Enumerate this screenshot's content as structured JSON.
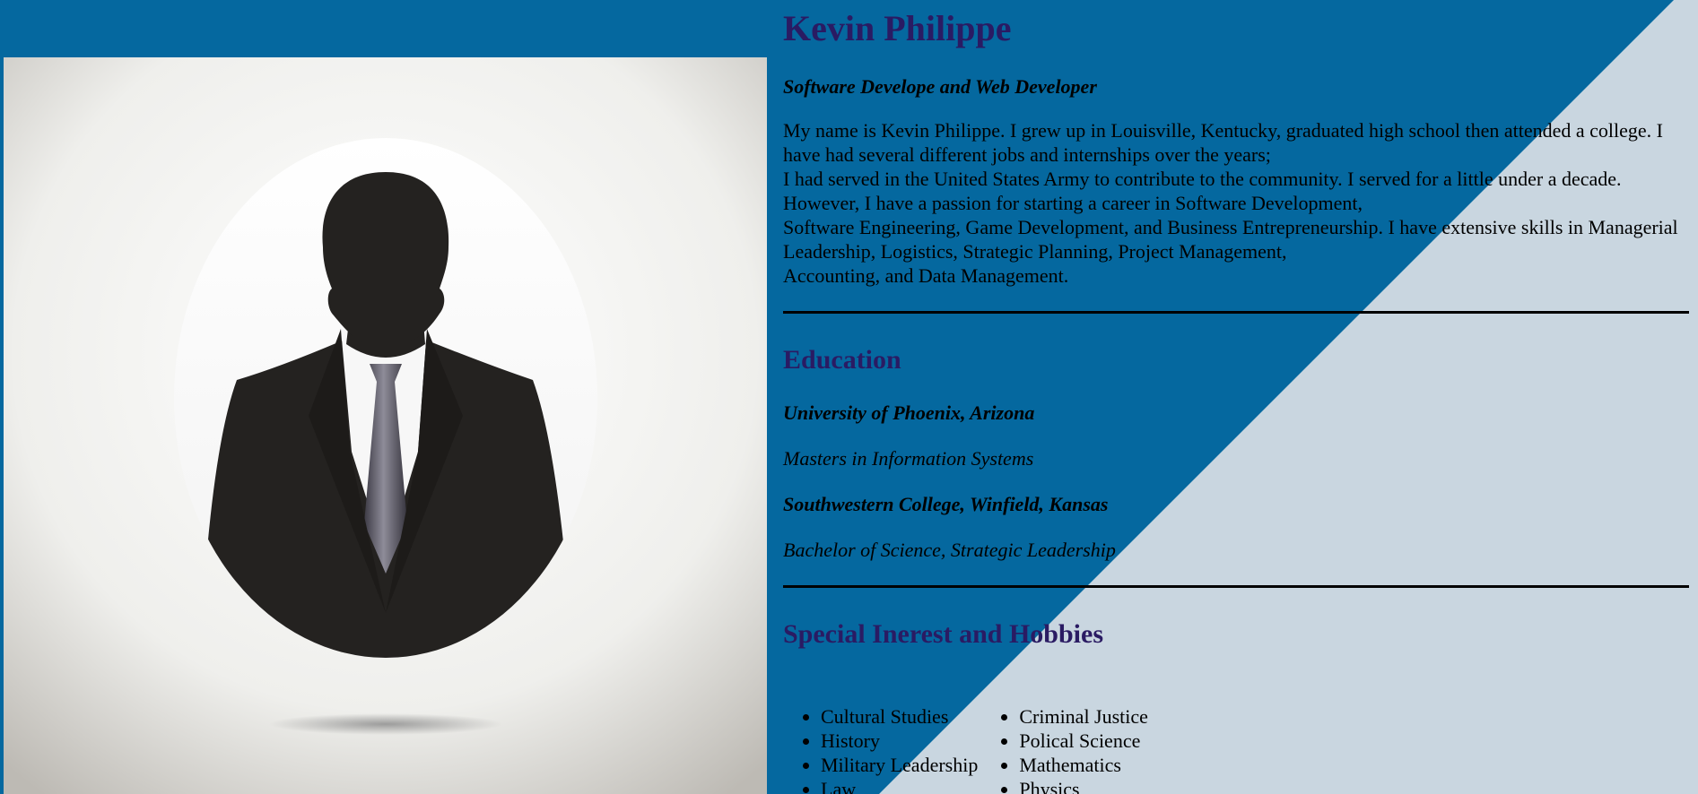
{
  "profile": {
    "name": "Kevin Philippe",
    "title": "Software Develope and Web Developer",
    "bio": [
      "My name is Kevin Philippe. I grew up in Louisville, Kentucky, graduated high school then attended a college. I have had several different jobs and internships over the years;",
      "I had served in the United States Army to contribute to the community. I served for a little under a decade. However, I have a passion for starting a career in Software Development,",
      "Software Engineering, Game Development, and Business Entrepreneurship. I have extensive skills in Managerial Leadership, Logistics, Strategic Planning, Project Management,",
      "Accounting, and Data Management."
    ]
  },
  "education": {
    "heading": "Education",
    "entries": [
      {
        "school": "University of Phoenix, Arizona",
        "degree": "Masters in Information Systems"
      },
      {
        "school": "Southwestern College, Winfield, Kansas",
        "degree": "Bachelor of Science, Strategic Leadership"
      }
    ]
  },
  "hobbies": {
    "heading": "Special Inerest and Hobbies",
    "column1": [
      "Cultural Studies",
      "History",
      "Military Leadership",
      "Law"
    ],
    "column2": [
      "Criminal Justice",
      "Polical Science",
      "Mathematics",
      "Physics"
    ]
  },
  "colors": {
    "blue": "#05689f",
    "light": "#c9d6e0",
    "heading": "#2a1b63"
  },
  "icons": {
    "profile_photo": "person-silhouette-icon"
  }
}
